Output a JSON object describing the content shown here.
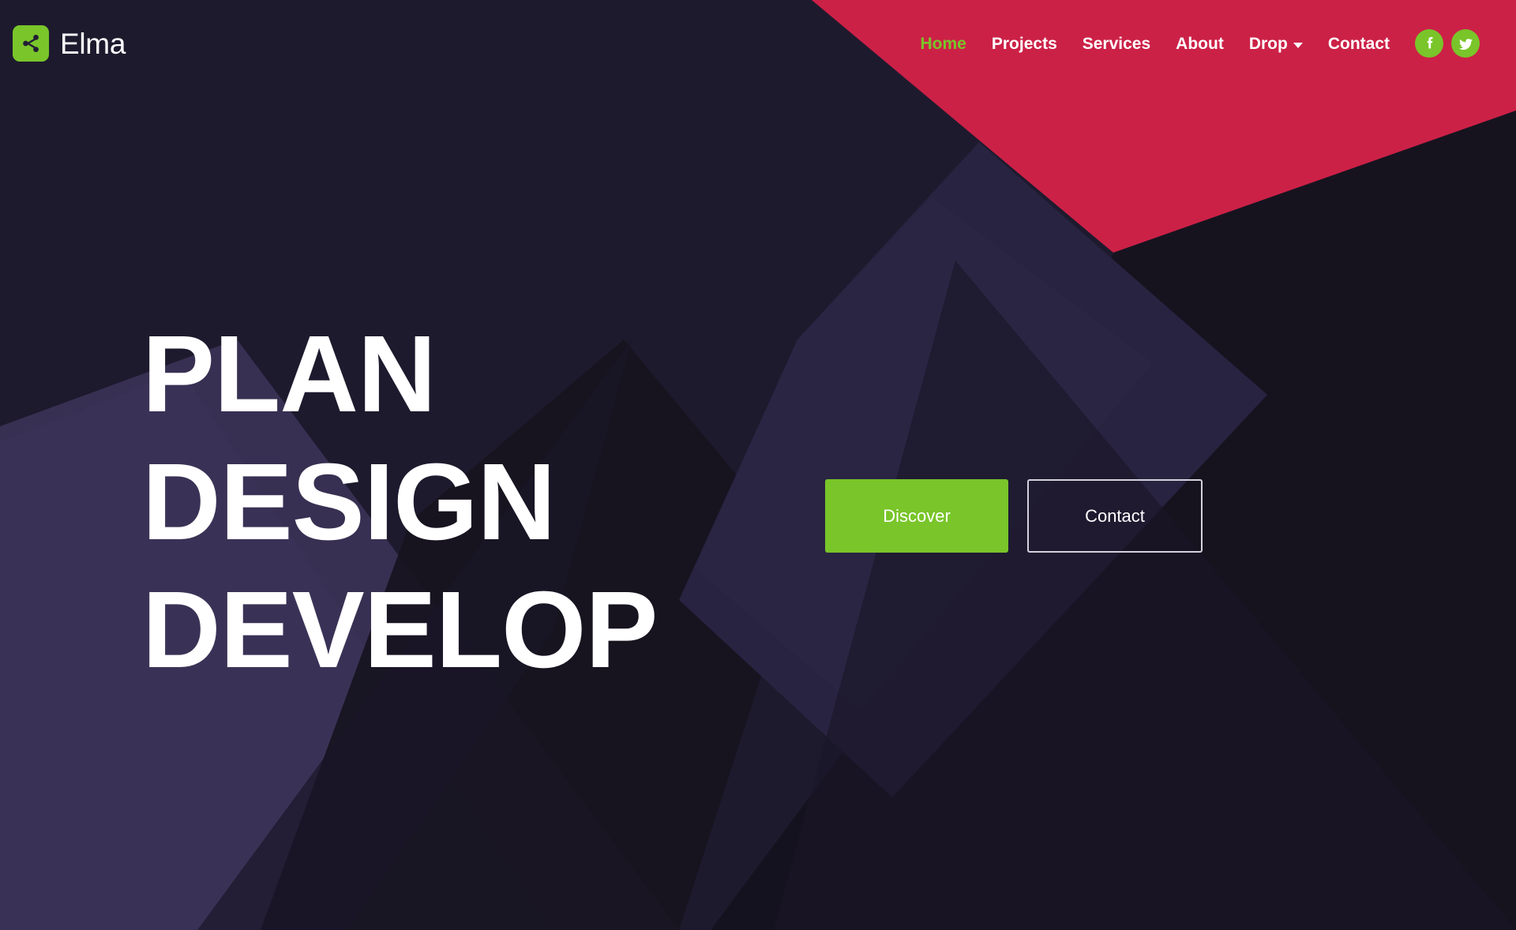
{
  "brand": {
    "name": "Elma",
    "logo_icon": "share-icon",
    "logo_bg": "#79c52a"
  },
  "nav": {
    "items": [
      {
        "label": "Home",
        "active": true,
        "has_dropdown": false
      },
      {
        "label": "Projects",
        "active": false,
        "has_dropdown": false
      },
      {
        "label": "Services",
        "active": false,
        "has_dropdown": false
      },
      {
        "label": "About",
        "active": false,
        "has_dropdown": false
      },
      {
        "label": "Drop",
        "active": false,
        "has_dropdown": true
      },
      {
        "label": "Contact",
        "active": false,
        "has_dropdown": false
      }
    ],
    "social": [
      {
        "label": "Facebook",
        "icon": "facebook-icon"
      },
      {
        "label": "Twitter",
        "icon": "twitter-icon"
      }
    ]
  },
  "hero": {
    "heading_lines": [
      "PLAN",
      "DESIGN",
      "DEVELOP"
    ],
    "primary_button": "Discover",
    "secondary_button": "Contact"
  },
  "colors": {
    "accent_green": "#79c52a",
    "accent_red": "#cc2147",
    "bg_dark": "#1e1a2e",
    "bg_darkest": "#15121f",
    "bg_purple": "#383052",
    "text_light": "#ffffff",
    "outline": "#d4d2dc"
  }
}
